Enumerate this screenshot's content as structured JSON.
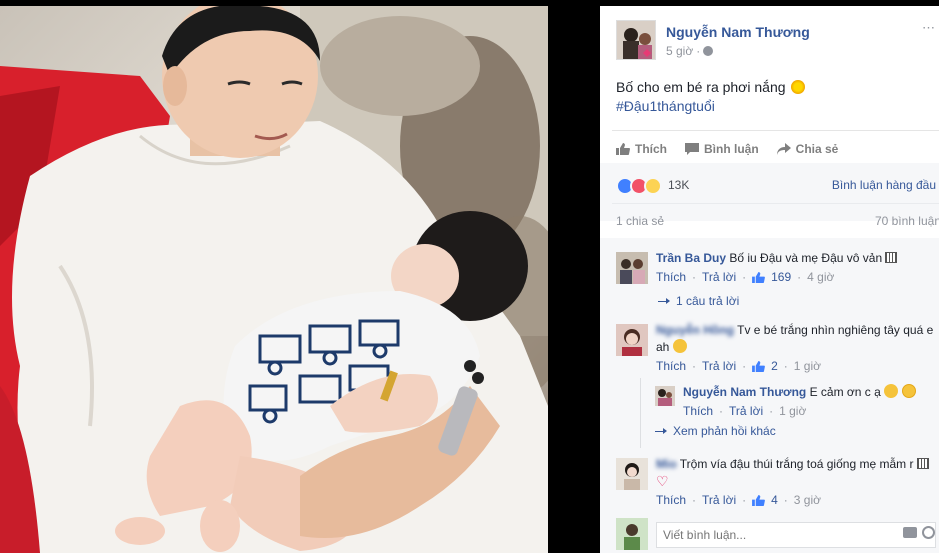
{
  "colors": {
    "link": "#365899",
    "muted": "#90949c",
    "panel_bg": "#f6f7f9"
  },
  "photo": {
    "icon": "photo-image"
  },
  "post": {
    "author": "Nguyễn Nam Thương",
    "time": "5 giờ",
    "privacy_icon": "globe-icon",
    "text": "Bố cho em bé ra phơi nắng",
    "hashtag": "#Đậu1thángtuổi"
  },
  "actions": {
    "like": "Thích",
    "comment": "Bình luận",
    "share": "Chia sẻ"
  },
  "reactions": {
    "count": "13K",
    "comment_order": "Bình luận hàng đầu",
    "shares": "1 chia sẻ",
    "comments": "70 bình luận"
  },
  "comments": [
    {
      "author": "Trần Ba Duy",
      "text": "Bố iu Đậu và mẹ Đậu vô vản",
      "like_label": "Thích",
      "reply_label": "Trả lời",
      "likes": "169",
      "time": "4 giờ",
      "replies_link": "1 câu trả lời"
    },
    {
      "author": "Nguyễn Hồng",
      "text": "Tv e bé trắng nhìn nghiêng tây quá e ah",
      "like_label": "Thích",
      "reply_label": "Trả lời",
      "likes": "2",
      "time": "1 giờ"
    },
    {
      "author": "Nguyễn Nam Thương",
      "text": "E cảm ơn c ạ",
      "like_label": "Thích",
      "reply_label": "Trả lời",
      "time": "1 giờ",
      "more_replies": "Xem phản hồi khác"
    },
    {
      "author": "Mio",
      "text": "Trộm vía đậu thúi trắng toá giống mẹ mẫm r",
      "like_label": "Thích",
      "reply_label": "Trả lời",
      "likes": "4",
      "time": "3 giờ"
    }
  ],
  "composer": {
    "placeholder": "Viết bình luận..."
  }
}
